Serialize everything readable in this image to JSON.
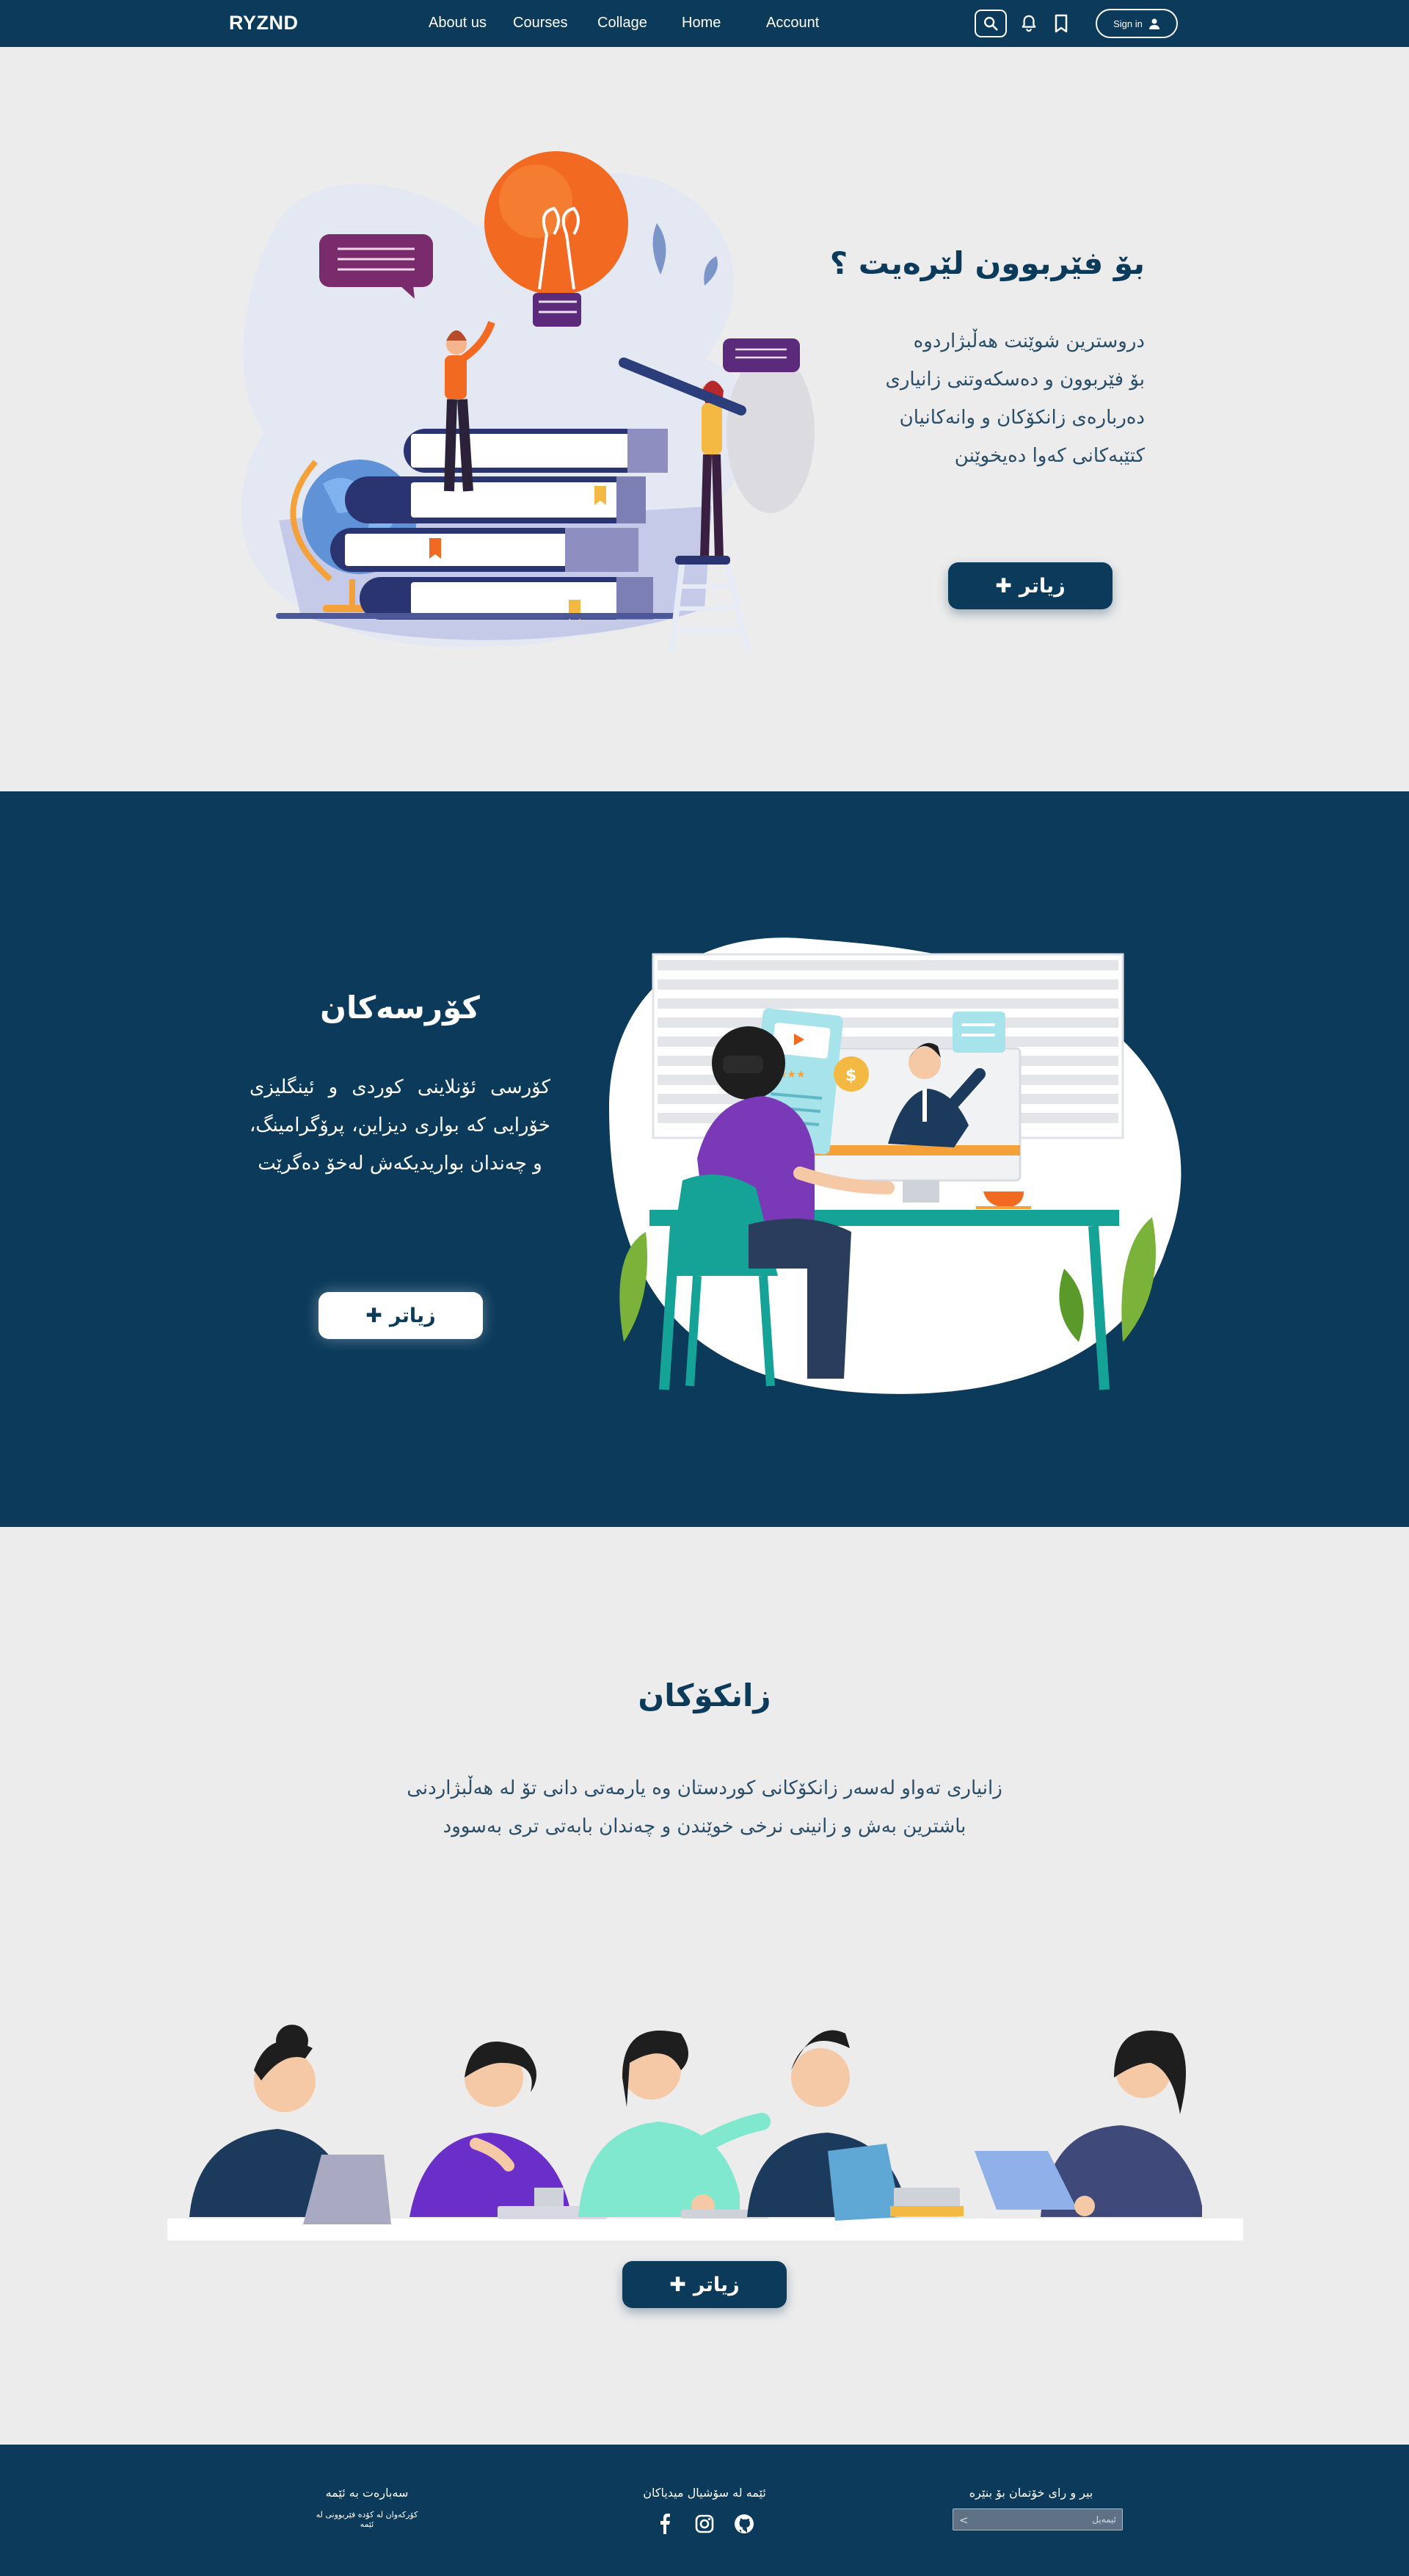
{
  "nav": {
    "brand": "RYZND",
    "links": [
      "About us",
      "Courses",
      "Collage",
      "Home",
      "Account"
    ],
    "signin": "Sign in"
  },
  "hero": {
    "title": "بۆ فێربوون لێرەیت ؟",
    "body": [
      "دروسترین شوێنت هەڵبژاردوە",
      "بۆ فێربوون و دەسکەوتنی زانیاری",
      "دەربارەی زانکۆکان و وانەکانیان",
      "کتێبەکانی کەوا دەیخوێنن"
    ],
    "button": "زیاتر"
  },
  "courses": {
    "title": "کۆرسەکان",
    "body": "کۆرسی ئۆنلاینی کوردی و ئینگلیزی خۆرایی کە بواری دیزاین، پرۆگرامینگ، و چەندان بواریدیکەش لەخۆ دەگرێت",
    "button": "زیاتر"
  },
  "colleges": {
    "title": "زانکۆکان",
    "body": [
      "زانیاری تەواو لەسەر زانکۆکانی کوردستان وە یارمەتی دانی تۆ لە هەڵبژاردنی",
      "باشترین بەش و زانینی نرخی خوێندن و چەندان بابەتی تری بەسوود"
    ],
    "button": "زیاتر"
  },
  "footer": {
    "about_title": "سەبارەت بە ئێمە",
    "about_sub": "کۆرکەوان لە کۆدە فێربوونی لە ئێمە",
    "social_title": "ئێمە لە سۆشیال میدیاکان",
    "social_icons": [
      "facebook-icon",
      "instagram-icon",
      "github-icon"
    ],
    "feedback_title": "بیر و رای خۆتمان بۆ بنێرە",
    "email_placeholder": "ئیمەیل"
  },
  "colors": {
    "primary": "#0b3a5a",
    "background": "#ececec",
    "accent_orange": "#f26a21"
  }
}
